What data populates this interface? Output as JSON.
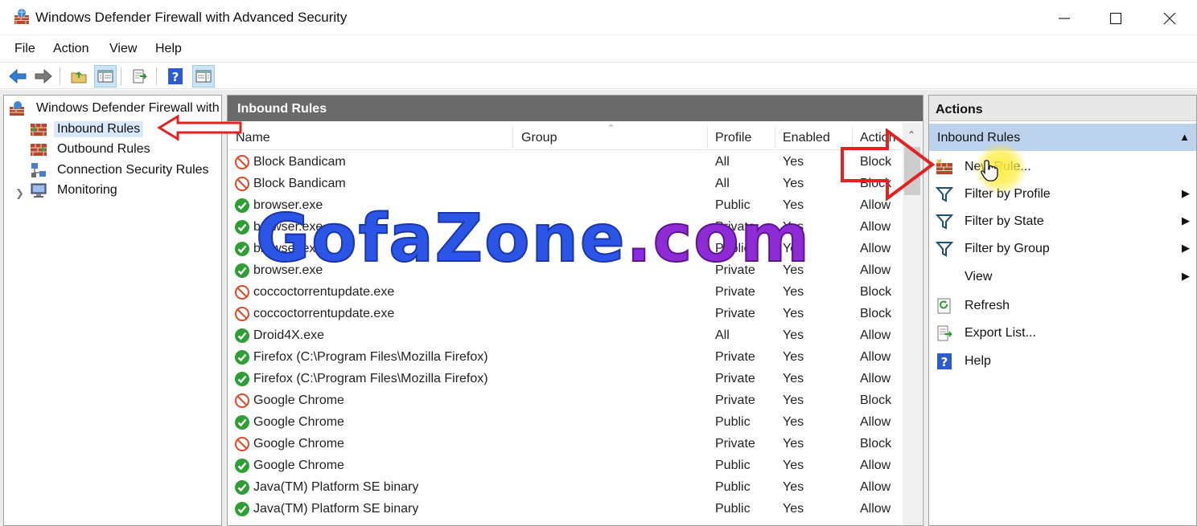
{
  "window": {
    "title": "Windows Defender Firewall with Advanced Security"
  },
  "menu": [
    "File",
    "Action",
    "View",
    "Help"
  ],
  "tree": {
    "root": "Windows Defender Firewall with",
    "items": [
      {
        "label": "Inbound Rules",
        "icon": "firewall-inbound-icon",
        "selected": true
      },
      {
        "label": "Outbound Rules",
        "icon": "firewall-outbound-icon",
        "selected": false
      },
      {
        "label": "Connection Security Rules",
        "icon": "connection-security-icon",
        "selected": false
      },
      {
        "label": "Monitoring",
        "icon": "monitoring-icon",
        "selected": false
      }
    ]
  },
  "center": {
    "title": "Inbound Rules",
    "columns": [
      "Name",
      "Group",
      "Profile",
      "Enabled",
      "Action"
    ],
    "rows": [
      {
        "name": "Block Bandicam",
        "group": "",
        "profile": "All",
        "enabled": "Yes",
        "action": "Block"
      },
      {
        "name": "Block Bandicam",
        "group": "",
        "profile": "All",
        "enabled": "Yes",
        "action": "Block"
      },
      {
        "name": "browser.exe",
        "group": "",
        "profile": "Public",
        "enabled": "Yes",
        "action": "Allow"
      },
      {
        "name": "browser.exe",
        "group": "",
        "profile": "Private",
        "enabled": "Yes",
        "action": "Allow"
      },
      {
        "name": "browser.exe",
        "group": "",
        "profile": "Public",
        "enabled": "Yes",
        "action": "Allow"
      },
      {
        "name": "browser.exe",
        "group": "",
        "profile": "Private",
        "enabled": "Yes",
        "action": "Allow"
      },
      {
        "name": "coccoctorrentupdate.exe",
        "group": "",
        "profile": "Private",
        "enabled": "Yes",
        "action": "Block"
      },
      {
        "name": "coccoctorrentupdate.exe",
        "group": "",
        "profile": "Private",
        "enabled": "Yes",
        "action": "Block"
      },
      {
        "name": "Droid4X.exe",
        "group": "",
        "profile": "All",
        "enabled": "Yes",
        "action": "Allow"
      },
      {
        "name": "Firefox (C:\\Program Files\\Mozilla Firefox)",
        "group": "",
        "profile": "Private",
        "enabled": "Yes",
        "action": "Allow"
      },
      {
        "name": "Firefox (C:\\Program Files\\Mozilla Firefox)",
        "group": "",
        "profile": "Private",
        "enabled": "Yes",
        "action": "Allow"
      },
      {
        "name": "Google Chrome",
        "group": "",
        "profile": "Private",
        "enabled": "Yes",
        "action": "Block"
      },
      {
        "name": "Google Chrome",
        "group": "",
        "profile": "Public",
        "enabled": "Yes",
        "action": "Allow"
      },
      {
        "name": "Google Chrome",
        "group": "",
        "profile": "Private",
        "enabled": "Yes",
        "action": "Block"
      },
      {
        "name": "Google Chrome",
        "group": "",
        "profile": "Public",
        "enabled": "Yes",
        "action": "Allow"
      },
      {
        "name": "Java(TM) Platform SE binary",
        "group": "",
        "profile": "Public",
        "enabled": "Yes",
        "action": "Allow"
      },
      {
        "name": "Java(TM) Platform SE binary",
        "group": "",
        "profile": "Public",
        "enabled": "Yes",
        "action": "Allow"
      }
    ]
  },
  "actions": {
    "title": "Actions",
    "section": "Inbound Rules",
    "items": [
      {
        "label": "New Rule...",
        "icon": "new-rule-icon",
        "submenu": false
      },
      {
        "label": "Filter by Profile",
        "icon": "filter-icon",
        "submenu": true
      },
      {
        "label": "Filter by State",
        "icon": "filter-icon",
        "submenu": true
      },
      {
        "label": "Filter by Group",
        "icon": "filter-icon",
        "submenu": true
      },
      {
        "label": "View",
        "icon": "",
        "submenu": true
      },
      {
        "label": "Refresh",
        "icon": "refresh-icon",
        "submenu": false
      },
      {
        "label": "Export List...",
        "icon": "export-icon",
        "submenu": false
      },
      {
        "label": "Help",
        "icon": "help-icon",
        "submenu": false
      }
    ]
  },
  "watermark": {
    "text": "GofaZone",
    "dot": ".",
    "tld": "com"
  },
  "colors": {
    "allow": "#2e9e35",
    "block": "#e0492a",
    "header_bg": "#6a6a6a",
    "selection": "#bcd2ec",
    "annotation_red": "#e52020"
  }
}
